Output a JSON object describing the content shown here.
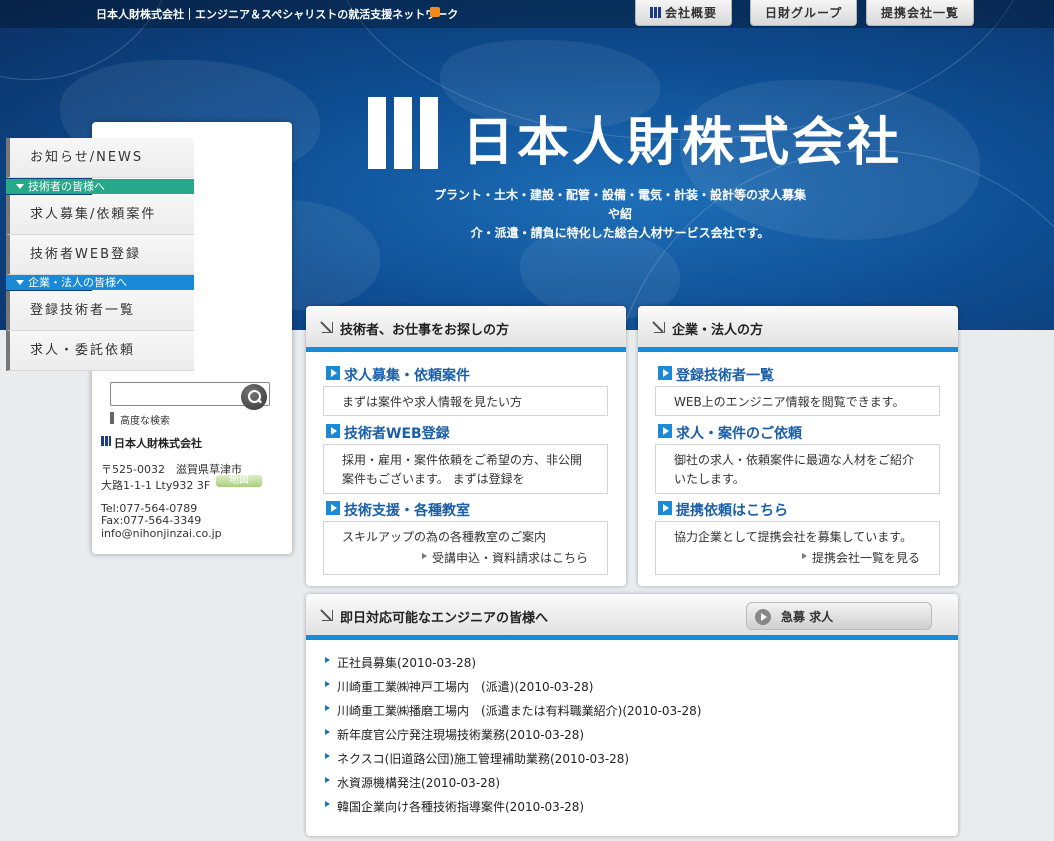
{
  "header": {
    "tagline": "日本人財株式会社｜エンジニア＆スペシャリストの就活支援ネットワーク",
    "nav": [
      {
        "label": "会社概要"
      },
      {
        "label": "日財グループ"
      },
      {
        "label": "提携会社一覧"
      }
    ]
  },
  "hero": {
    "logo_text": "日本人財株式会社",
    "description_line1": "プラント・土木・建設・配管・設備・電気・計装・設計等の求人募集や紹",
    "description_line2": "介・派遣・請負に特化した総合人材サービス会社です。"
  },
  "sidebar": {
    "news": "お知らせ/NEWS",
    "engineers_heading": "技術者の皆様へ",
    "jobs": "求人募集/依頼案件",
    "web_register": "技術者WEB登録",
    "corporate_heading": "企業・法人の皆様へ",
    "registered_list": "登録技術者一覧",
    "request": "求人・委託依頼",
    "search": {
      "value": "",
      "placeholder": ""
    },
    "advanced_search": "高度な検索",
    "company_name": "日本人財株式会社",
    "postal": "〒525-0032　滋賀県草津市",
    "address": "大路1-1-1 Lty932 3F",
    "map_button": "地図",
    "tel": "Tel:077-564-0789",
    "fax": "Fax:077-564-3349",
    "email": "info@nihonjinzai.co.jp"
  },
  "engineers_panel": {
    "title": "技術者、お仕事をお探しの方",
    "sections": [
      {
        "title": "求人募集・依頼案件",
        "text": "まずは案件や求人情報を見たい方"
      },
      {
        "title": "技術者WEB登録",
        "text1": "採用・雇用・案件依頼をご希望の方、非公開",
        "text2": "案件もございます。 まずは登録を"
      },
      {
        "title": "技術支援・各種教室",
        "text": "スキルアップの為の各種教室のご案内",
        "link": "受講申込・資料請求はこちら"
      }
    ]
  },
  "corporate_panel": {
    "title": "企業・法人の方",
    "sections": [
      {
        "title": "登録技術者一覧",
        "text": "WEB上のエンジニア情報を閲覧できます。"
      },
      {
        "title": "求人・案件のご依頼",
        "text1": "御社の求人・依頼案件に最適な人材をご紹介",
        "text2": "いたします。"
      },
      {
        "title": "提携依頼はこちら",
        "text": "協力企業として提携会社を募集しています。",
        "link": "提携会社一覧を見る"
      }
    ]
  },
  "urgent_panel": {
    "title": "即日対応可能なエンジニアの皆様へ",
    "button": "急募 求人",
    "jobs": [
      "正社員募集(2010-03-28)",
      "川崎重工業㈱神戸工場内　(派遣)(2010-03-28)",
      "川崎重工業㈱播磨工場内　(派遣または有料職業紹介)(2010-03-28)",
      "新年度官公庁発注現場技術業務(2010-03-28)",
      "ネクスコ(旧道路公団)施工管理補助業務(2010-03-28)",
      "水資源機構発注(2010-03-28)",
      "韓国企業向け各種技術指導案件(2010-03-28)"
    ]
  },
  "colors": {
    "accent": "#1b8ad6",
    "engineers_head": "#27a88a",
    "corporate_head": "#1b8ad6",
    "hero": "#0e4e93"
  }
}
